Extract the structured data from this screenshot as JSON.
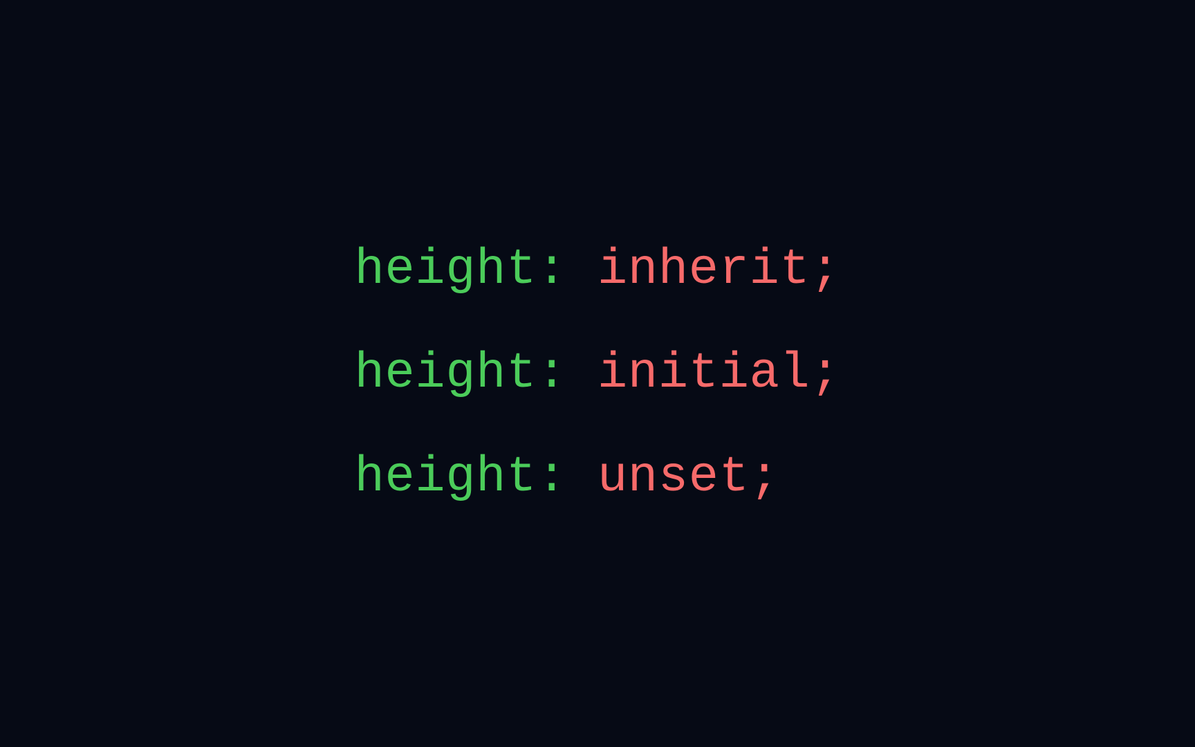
{
  "code": {
    "lines": [
      {
        "property": "height",
        "value": "inherit"
      },
      {
        "property": "height",
        "value": "initial"
      },
      {
        "property": "height",
        "value": "unset"
      }
    ]
  }
}
